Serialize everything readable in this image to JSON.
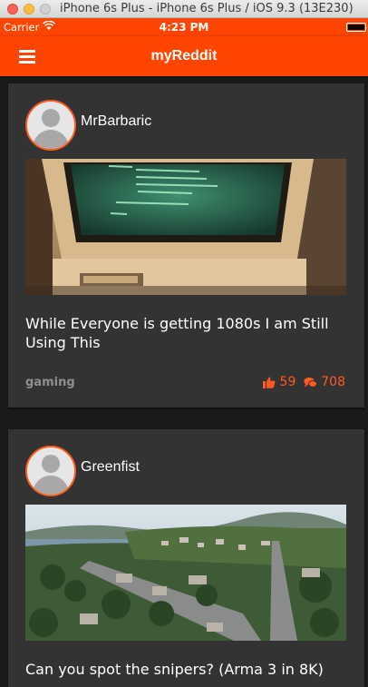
{
  "window": {
    "title": "iPhone 6s Plus - iPhone 6s Plus / iOS 9.3 (13E230)"
  },
  "status_bar": {
    "carrier": "Carrier",
    "time": "4:23 PM"
  },
  "nav": {
    "title": "myReddit",
    "menu_icon": "hamburger-menu-icon"
  },
  "colors": {
    "accent": "#ff4500",
    "card": "#333333",
    "background": "#1a1a1a",
    "meta": "#8f8f8f"
  },
  "posts": [
    {
      "author": "MrBarbaric",
      "title": "While Everyone is getting 1080s I am Still Using This",
      "subreddit": "gaming",
      "upvotes": "59",
      "comments": "708",
      "image": "old computer monitor with green text"
    },
    {
      "author": "Greenfist",
      "title": "Can you spot the snipers? (Arma 3 in 8K)",
      "image": "aerial view of coastal town"
    }
  ]
}
